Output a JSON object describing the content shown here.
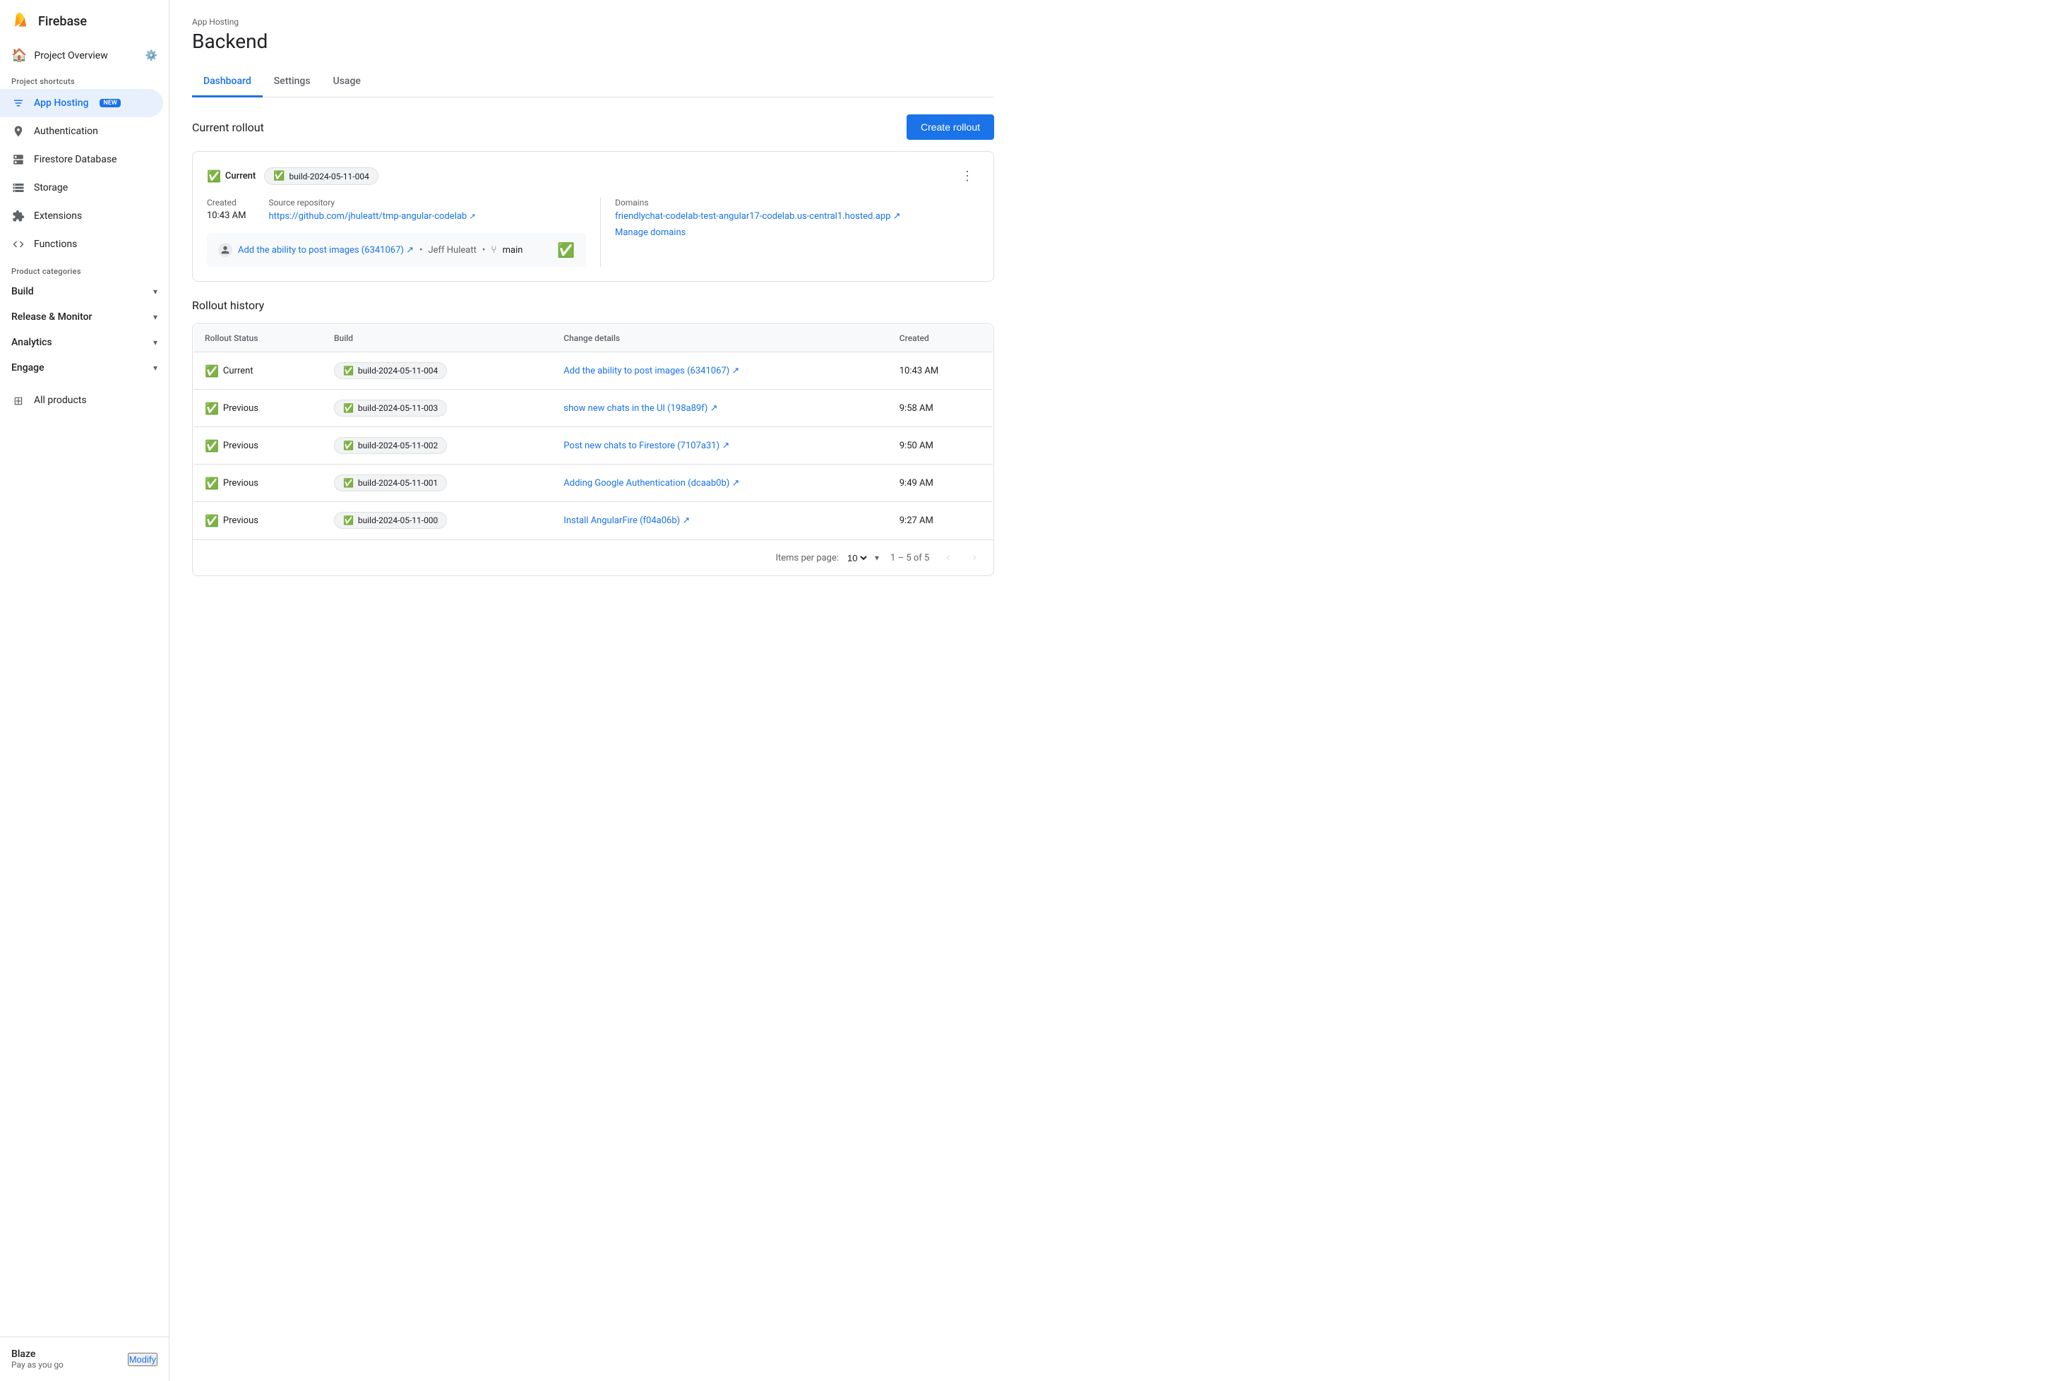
{
  "sidebar": {
    "app_title": "Firebase",
    "project_overview": "Project Overview",
    "project_shortcuts_label": "Project shortcuts",
    "nav_items": [
      {
        "id": "app-hosting",
        "label": "App Hosting",
        "badge": "NEW",
        "active": true,
        "icon": "grid"
      },
      {
        "id": "authentication",
        "label": "Authentication",
        "active": false,
        "icon": "person"
      },
      {
        "id": "firestore",
        "label": "Firestore Database",
        "active": false,
        "icon": "database"
      },
      {
        "id": "storage",
        "label": "Storage",
        "active": false,
        "icon": "storage"
      },
      {
        "id": "extensions",
        "label": "Extensions",
        "active": false,
        "icon": "extension"
      },
      {
        "id": "functions",
        "label": "Functions",
        "active": false,
        "icon": "code"
      }
    ],
    "product_categories_label": "Product categories",
    "categories": [
      {
        "id": "build",
        "label": "Build"
      },
      {
        "id": "release-monitor",
        "label": "Release & Monitor"
      },
      {
        "id": "analytics",
        "label": "Analytics"
      },
      {
        "id": "engage",
        "label": "Engage"
      }
    ],
    "all_products": "All products",
    "footer": {
      "plan_name": "Blaze",
      "plan_sub": "Pay as you go",
      "modify_label": "Modify"
    }
  },
  "header": {
    "breadcrumb": "App Hosting",
    "title": "Backend"
  },
  "tabs": [
    {
      "id": "dashboard",
      "label": "Dashboard",
      "active": true
    },
    {
      "id": "settings",
      "label": "Settings",
      "active": false
    },
    {
      "id": "usage",
      "label": "Usage",
      "active": false
    }
  ],
  "current_rollout": {
    "section_title": "Current rollout",
    "create_rollout_label": "Create rollout",
    "status_label": "Current",
    "build_id": "build-2024-05-11-004",
    "created_label": "Created",
    "created_value": "10:43 AM",
    "source_repo_label": "Source repository",
    "source_repo_url": "https://github.com/jhuleatt/tmp-angular-codelab",
    "source_repo_display": "https://github.com/jhuleatt/tmp-angular-codelab ↗",
    "domains_label": "Domains",
    "domain_url": "friendlychat-codelab-test-angular17-codelab.us-central1.hosted.app",
    "domain_display": "friendlychat-codelab-test-angular17-codelab.us-central1.hosted.app ↗",
    "manage_domains_label": "Manage domains",
    "commit_message": "Add the ability to post images (6341067) ↗",
    "commit_author": "Jeff Huleatt",
    "commit_branch": "main"
  },
  "rollout_history": {
    "section_title": "Rollout history",
    "columns": [
      "Rollout Status",
      "Build",
      "Change details",
      "Created"
    ],
    "rows": [
      {
        "status": "Current",
        "build": "build-2024-05-11-004",
        "change_details": "Add the ability to post images (6341067) ↗",
        "created": "10:43 AM"
      },
      {
        "status": "Previous",
        "build": "build-2024-05-11-003",
        "change_details": "show new chats in the UI (198a89f) ↗",
        "created": "9:58 AM"
      },
      {
        "status": "Previous",
        "build": "build-2024-05-11-002",
        "change_details": "Post new chats to Firestore (7107a31) ↗",
        "created": "9:50 AM"
      },
      {
        "status": "Previous",
        "build": "build-2024-05-11-001",
        "change_details": "Adding Google Authentication (dcaab0b) ↗",
        "created": "9:49 AM"
      },
      {
        "status": "Previous",
        "build": "build-2024-05-11-000",
        "change_details": "Install AngularFire (f04a06b) ↗",
        "created": "9:27 AM"
      }
    ],
    "footer": {
      "items_per_page_label": "Items per page:",
      "items_per_page_value": "10",
      "pagination_info": "1 – 5 of 5"
    }
  }
}
